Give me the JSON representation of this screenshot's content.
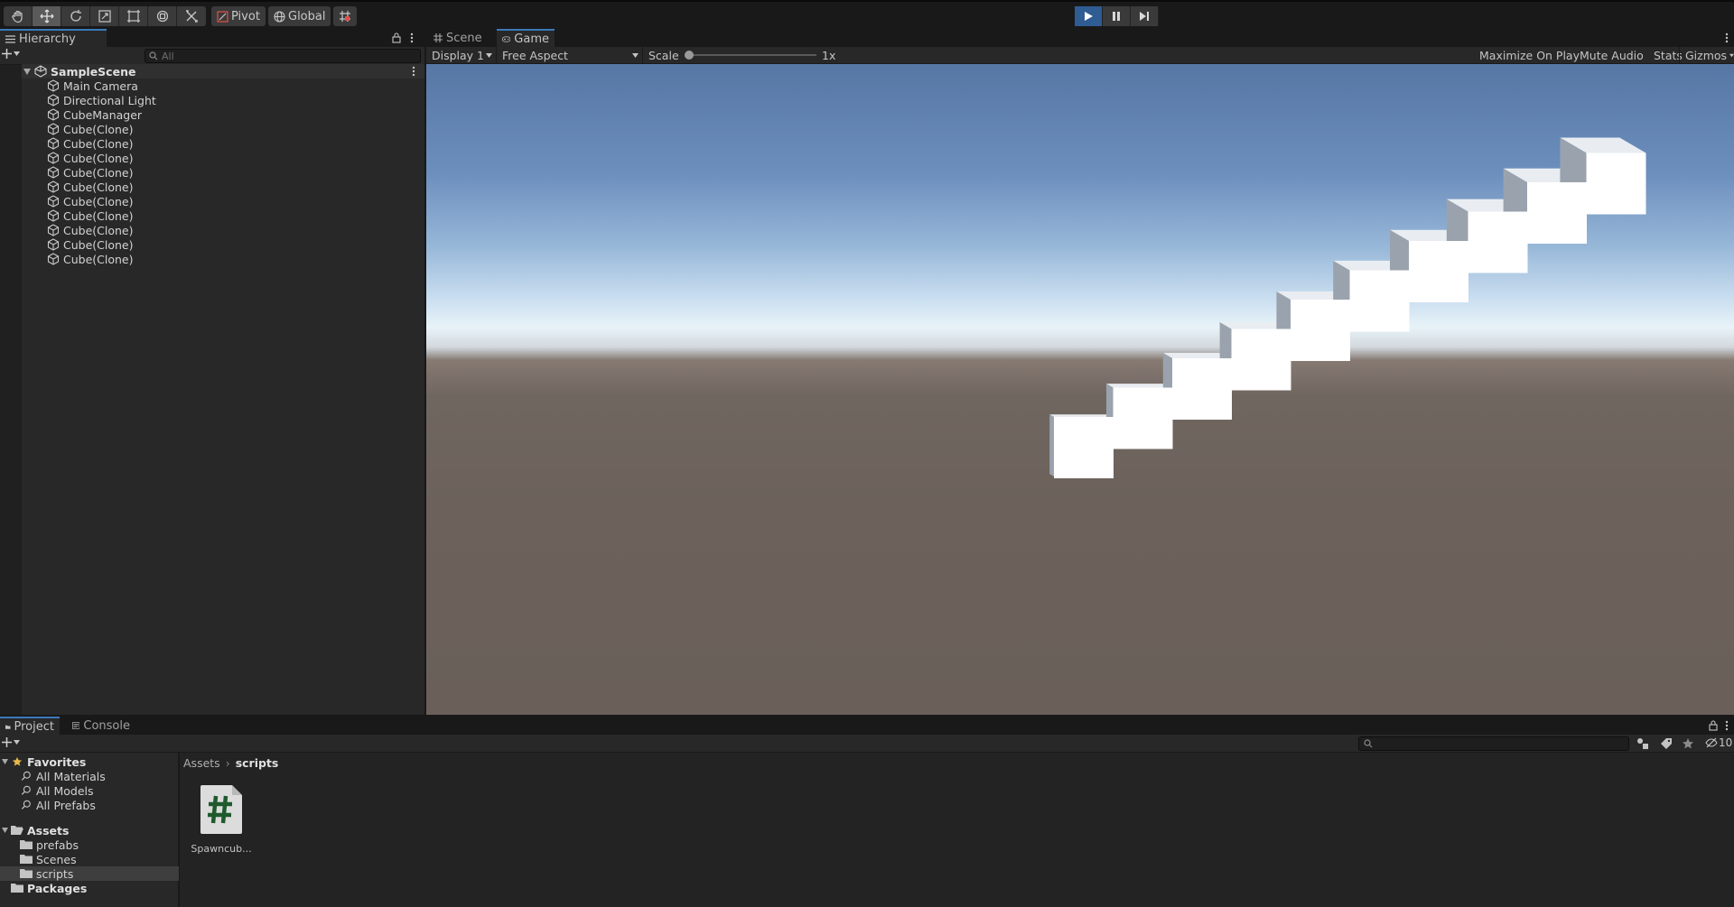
{
  "toolbar": {
    "tools": [
      "hand-tool",
      "move-tool",
      "rotate-tool",
      "scale-tool",
      "rect-tool",
      "transform-tool",
      "custom-tool"
    ],
    "pivot_label": "Pivot",
    "global_label": "Global"
  },
  "hierarchy": {
    "tab_label": "Hierarchy",
    "search_placeholder": "All",
    "scene_name": "SampleScene",
    "items": [
      {
        "label": "Main Camera"
      },
      {
        "label": "Directional Light"
      },
      {
        "label": "CubeManager"
      },
      {
        "label": "Cube(Clone)"
      },
      {
        "label": "Cube(Clone)"
      },
      {
        "label": "Cube(Clone)"
      },
      {
        "label": "Cube(Clone)"
      },
      {
        "label": "Cube(Clone)"
      },
      {
        "label": "Cube(Clone)"
      },
      {
        "label": "Cube(Clone)"
      },
      {
        "label": "Cube(Clone)"
      },
      {
        "label": "Cube(Clone)"
      },
      {
        "label": "Cube(Clone)"
      }
    ]
  },
  "game": {
    "tabs": [
      {
        "label": "Scene"
      },
      {
        "label": "Game"
      }
    ],
    "display": "Display 1",
    "aspect": "Free Aspect",
    "scale_label": "Scale",
    "scale_value": "1x",
    "scale_level": 0,
    "maximize_label": "Maximize On Play",
    "mute_label": "Mute Audio",
    "stats_label": "Stats",
    "gizmos_label": "Gizmos"
  },
  "project": {
    "tabs": [
      {
        "label": "Project"
      },
      {
        "label": "Console"
      }
    ],
    "hidden_count": "10",
    "favorites_label": "Favorites",
    "favorites": [
      {
        "label": "All Materials"
      },
      {
        "label": "All Models"
      },
      {
        "label": "All Prefabs"
      }
    ],
    "assets_label": "Assets",
    "folders": [
      {
        "label": "prefabs"
      },
      {
        "label": "Scenes"
      },
      {
        "label": "scripts"
      }
    ],
    "packages_label": "Packages",
    "breadcrumb": [
      "Assets",
      "scripts"
    ],
    "files": [
      {
        "label": "Spawncub..."
      }
    ]
  },
  "colors": {
    "accent": "#3a79bb",
    "play_active": "#2f5c93",
    "script_icon_green": "#1f5a2c"
  }
}
